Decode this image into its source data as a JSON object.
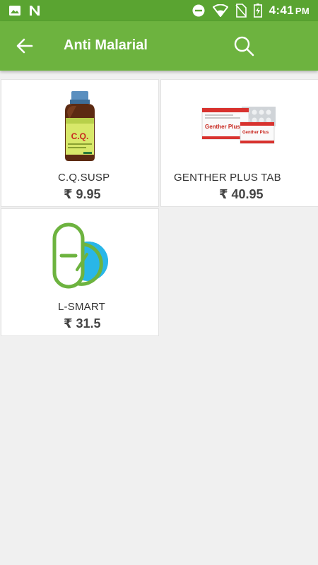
{
  "status_bar": {
    "time": "4:41",
    "ampm": "PM",
    "icons": [
      "image-icon",
      "n-icon",
      "dnd-icon",
      "wifi-icon",
      "no-sim-icon",
      "battery-charging-icon"
    ]
  },
  "app_bar": {
    "title": "Anti Malarial",
    "back_icon": "arrow-left-icon",
    "search_icon": "search-icon",
    "color": "#6db33f"
  },
  "products": [
    {
      "name": "C.Q.SUSP",
      "price": "₹ 9.95",
      "image": "syrup-bottle"
    },
    {
      "name": "GENTHER PLUS TAB",
      "price": "₹ 40.95",
      "image": "tablet-box"
    },
    {
      "name": "L-SMART",
      "price": "₹ 31.5",
      "image": "capsule-placeholder"
    }
  ]
}
